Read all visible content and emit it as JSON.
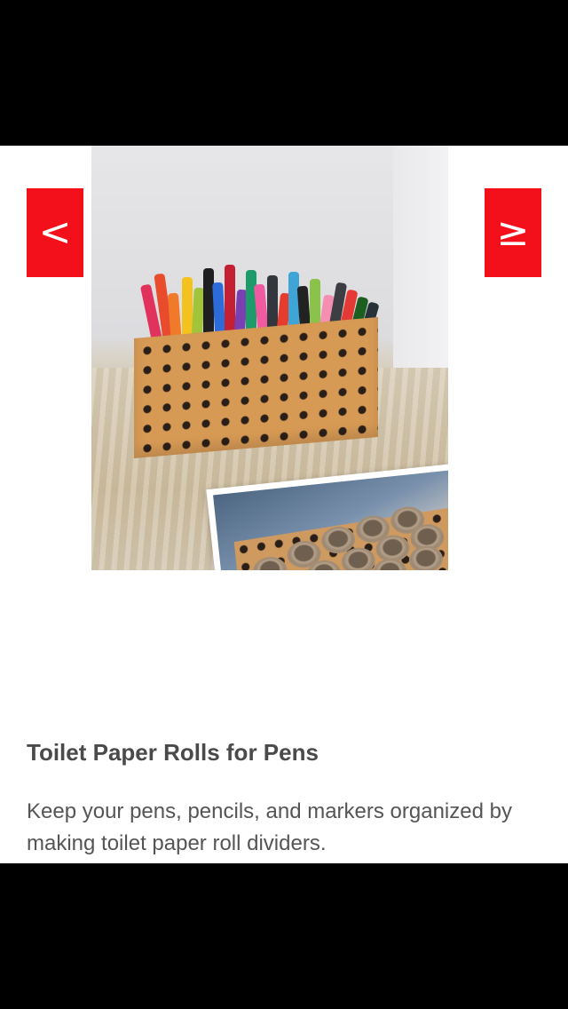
{
  "nav": {
    "prev_label": "<",
    "next_label": "≥"
  },
  "article": {
    "title": "Toilet Paper Rolls for Pens",
    "description": "Keep your pens, pencils, and markers organized by making toilet paper roll dividers."
  },
  "colors": {
    "nav_button": "#f3101a",
    "title_text": "#4a4a4a",
    "body_text": "#555555",
    "background": "#ffffff"
  }
}
